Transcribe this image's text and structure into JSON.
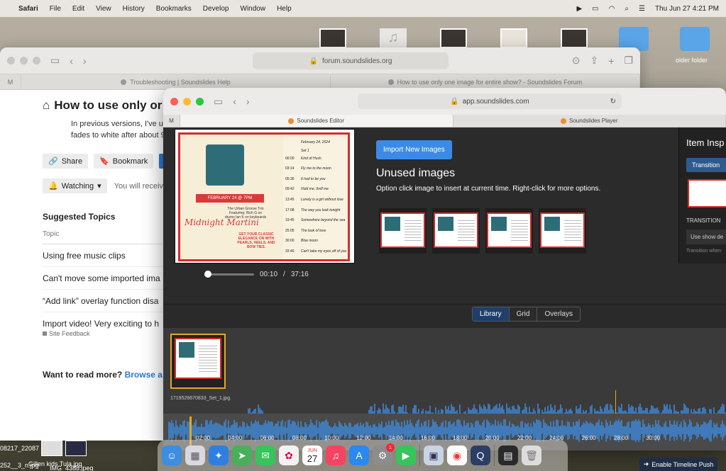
{
  "menubar": {
    "app": "Safari",
    "items": [
      "File",
      "Edit",
      "View",
      "History",
      "Bookmarks",
      "Develop",
      "Window",
      "Help"
    ],
    "clock": "Thu Jun 27  4:21 PM"
  },
  "desktop": {
    "folder_label": "older folder",
    "files": [
      "08217_22087",
      "252__3_n.jpg",
      "Gillen kids Tula.jpg",
      "IMG_4388.jpeg"
    ]
  },
  "back_window": {
    "url": "forum.soundslides.org",
    "tabs": [
      "Troubleshooting | Soundslides Help",
      "How to use only one image for entire show? - Soundslides Forum"
    ],
    "title": "How to use only or",
    "body_text": "In previous versions, I've up fades to white after about 9",
    "buttons": {
      "share": "Share",
      "bookmark": "Bookmark"
    },
    "watching": {
      "label": "Watching",
      "note": "You will receive"
    },
    "suggested": {
      "heading": "Suggested Topics",
      "column": "Topic",
      "rows": [
        "Using free music clips",
        "Can't move some imported ima",
        "“Add link” overlay function disa",
        "Import video! Very exciting to h"
      ],
      "sub_label": "Site Feedback"
    },
    "read_more": {
      "text": "Want to read more?",
      "link": "Browse a"
    }
  },
  "front_window": {
    "url": "app.soundslides.com",
    "tabs": [
      "Soundslides Editor",
      "Soundslides Player"
    ],
    "preview": {
      "banner": "FEBRUARY 24 @ 7PM",
      "band": "The Urban Groove Trio",
      "featuring": "Featuring: Rich G on drums Ian K on keyboards",
      "script_title": "Midnight Martini",
      "tagline": "GET YOUR CLASSIC ELEGANCE ON WITH PEARLS, HEELS, AND BOW TIES.",
      "setlist_date": "February 24, 2024",
      "setlist_label": "Set 1",
      "setlist": [
        {
          "t": "00:00",
          "s": "Kind of Hush"
        },
        {
          "t": "03:14",
          "s": "Fly me to the moon"
        },
        {
          "t": "05:36",
          "s": "It had to be you"
        },
        {
          "t": "09:42",
          "s": "Hold me, thrill me"
        },
        {
          "t": "13:45",
          "s": "Lonely is a girl without love"
        },
        {
          "t": "17:08",
          "s": "The way you look tonight"
        },
        {
          "t": "19:45",
          "s": "Somewhere beyond the sea"
        },
        {
          "t": "25:05",
          "s": "The look of love"
        },
        {
          "t": "30:00",
          "s": "Blue moon"
        },
        {
          "t": "33:40",
          "s": "Can't take my eyes off of you"
        }
      ]
    },
    "playback": {
      "current": "00:10",
      "separator": "/",
      "total": "37:16",
      "progress": 0.0045
    },
    "library": {
      "import_label": "Import New Images",
      "title": "Unused images",
      "hint": "Option click image to insert at current time. Right-click for more options.",
      "tabs": [
        "Library",
        "Grid",
        "Overlays"
      ],
      "active_tab": "Library"
    },
    "inspector": {
      "title": "Item Insp",
      "button": "Transition",
      "section": "TRANSITION",
      "select": "Use show de",
      "more": "Transition when"
    },
    "timeline": {
      "clip_name": "1719526670833_Set_1.jpg",
      "ticks": [
        "00:01",
        "00:02",
        "00:03",
        "00:04",
        "00:05",
        "00:06",
        "00:07",
        "00:08",
        "00:09",
        "00:10",
        "00:11",
        "00:12"
      ],
      "overview_ticks": [
        "02:00",
        "04:00",
        "06:00",
        "08:00",
        "10:00",
        "12:00",
        "14:00",
        "16:00",
        "18:00",
        "20:00",
        "22:00",
        "24:00",
        "26:00",
        "28:00",
        "30:00"
      ]
    }
  },
  "dock": {
    "calendar_month": "JUN",
    "calendar_day": "27",
    "badge": "1"
  },
  "timeline_push": "Enable Timeline Push",
  "colors": {
    "accent": "#3b8be6",
    "poster_red": "#d32c2c",
    "wave": "#3f86d3",
    "playhead": "#e6a723"
  }
}
